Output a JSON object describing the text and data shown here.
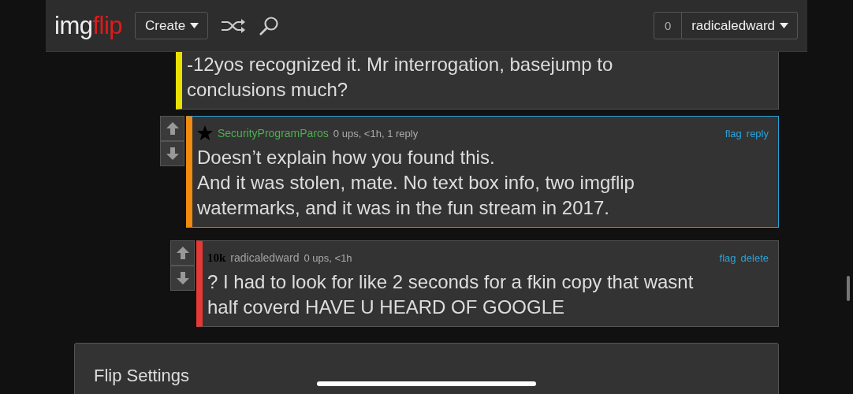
{
  "header": {
    "logo": {
      "part_1": "img",
      "part_2": "flip"
    },
    "create_button": "Create",
    "notification_count": "0",
    "user_menu": "radicaledward"
  },
  "comments": [
    {
      "color": "#e8e000",
      "selected": false,
      "text": "-12yos recognized it. Mr interrogation, basejump to\nconclusions much?",
      "children": [
        {
          "color": "#f08a10",
          "selected": true,
          "badge": {
            "kind": "star"
          },
          "author": {
            "name": "SecurityProgramParos",
            "color": "#4caf50"
          },
          "meta": "0 ups, <1h, 1 reply",
          "actions": [
            "flag",
            "reply"
          ],
          "text": "Doesn’t explain how you found this.\nAnd it was stolen, mate. No text box info, two imgflip\nwatermarks, and it was in the fun stream in 2017.",
          "children": [
            {
              "color": "#e53935",
              "selected": false,
              "badge": {
                "kind": "points",
                "label": "10k"
              },
              "author": {
                "name": "radicaledward",
                "color": "#a0a0a0"
              },
              "meta": "0 ups, <1h",
              "actions": [
                "flag",
                "delete"
              ],
              "text": "? I had to look for like 2 seconds for a fkin copy that wasnt\nhalf coverd HAVE U HEARD OF GOOGLE"
            }
          ]
        }
      ]
    }
  ],
  "settings_panel": {
    "title": "Flip Settings"
  }
}
